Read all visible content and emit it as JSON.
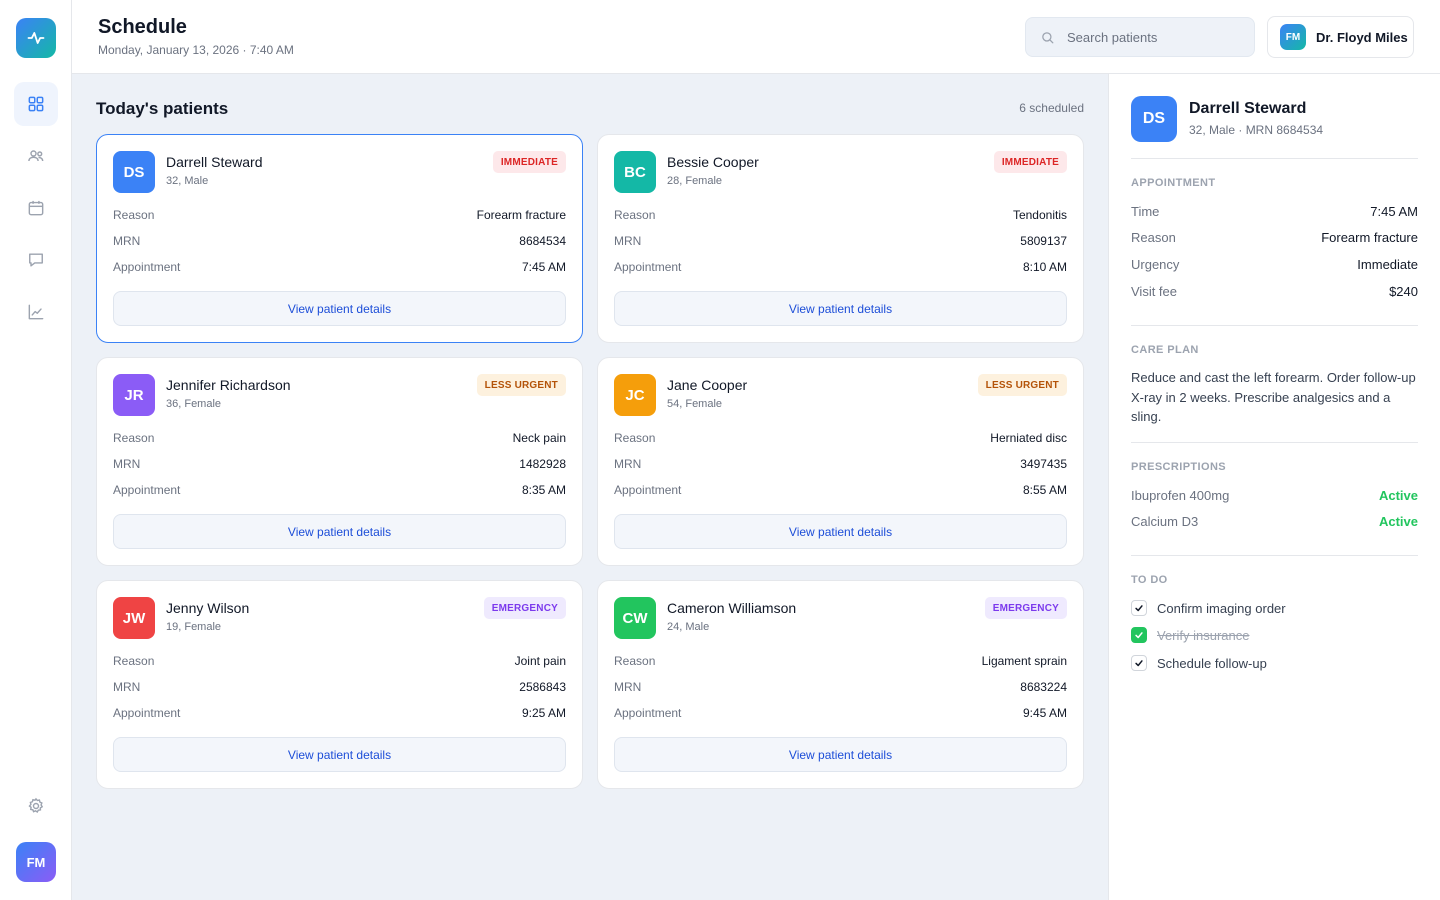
{
  "header": {
    "title": "Schedule",
    "date": "Monday, January 13, 2026 · 7:40 AM",
    "search_placeholder": "Search patients",
    "user_initials": "FM",
    "user_name": "Dr. Floyd Miles"
  },
  "sidebar": {
    "items": [
      {
        "icon": "dashboard-icon",
        "active": true
      },
      {
        "icon": "patients-icon",
        "active": false
      },
      {
        "icon": "calendar-icon",
        "active": false
      },
      {
        "icon": "chat-icon",
        "active": false
      },
      {
        "icon": "analytics-icon",
        "active": false
      }
    ],
    "settings_icon": "gear-icon",
    "avatar_initials": "FM"
  },
  "main": {
    "section_title": "Today's patients",
    "scheduled_count": "6 scheduled",
    "row_labels": {
      "reason": "Reason",
      "mrn": "MRN",
      "appointment": "Appointment"
    },
    "button_label": "View patient details",
    "patients": [
      {
        "initials": "DS",
        "name": "Darrell Steward",
        "meta": "32, Male",
        "badge": "IMMEDIATE",
        "badge_type": "immediate",
        "reason": "Forearm fracture",
        "mrn": "8684534",
        "appointment": "7:45 AM",
        "color": "#3b82f6"
      },
      {
        "initials": "BC",
        "name": "Bessie Cooper",
        "meta": "28, Female",
        "badge": "IMMEDIATE",
        "badge_type": "immediate",
        "reason": "Tendonitis",
        "mrn": "5809137",
        "appointment": "8:10 AM",
        "color": "#14b8a6"
      },
      {
        "initials": "JR",
        "name": "Jennifer Richardson",
        "meta": "36, Female",
        "badge": "LESS URGENT",
        "badge_type": "less",
        "reason": "Neck pain",
        "mrn": "1482928",
        "appointment": "8:35 AM",
        "color": "#8b5cf6"
      },
      {
        "initials": "JC",
        "name": "Jane Cooper",
        "meta": "54, Female",
        "badge": "LESS URGENT",
        "badge_type": "less",
        "reason": "Herniated disc",
        "mrn": "3497435",
        "appointment": "8:55 AM",
        "color": "#f59e0b"
      },
      {
        "initials": "JW",
        "name": "Jenny Wilson",
        "meta": "19, Female",
        "badge": "EMERGENCY",
        "badge_type": "emergency",
        "reason": "Joint pain",
        "mrn": "2586843",
        "appointment": "9:25 AM",
        "color": "#ef4444"
      },
      {
        "initials": "CW",
        "name": "Cameron Williamson",
        "meta": "24, Male",
        "badge": "EMERGENCY",
        "badge_type": "emergency",
        "reason": "Ligament sprain",
        "mrn": "8683224",
        "appointment": "9:45 AM",
        "color": "#22c55e"
      }
    ]
  },
  "detail": {
    "initials": "DS",
    "name": "Darrell Steward",
    "meta": "32, Male · MRN 8684534",
    "appointment_heading": "APPOINTMENT",
    "appointment": [
      {
        "label": "Time",
        "value": "7:45 AM"
      },
      {
        "label": "Reason",
        "value": "Forearm fracture"
      },
      {
        "label": "Urgency",
        "value": "Immediate"
      },
      {
        "label": "Visit fee",
        "value": "$240"
      }
    ],
    "careplan_heading": "CARE PLAN",
    "careplan_text": "Reduce and cast the left forearm. Order follow-up X-ray in 2 weeks. Prescribe analgesics and a sling.",
    "prescriptions_heading": "PRESCRIPTIONS",
    "prescriptions": [
      {
        "name": "Ibuprofen 400mg",
        "status": "Active"
      },
      {
        "name": "Calcium D3",
        "status": "Active"
      }
    ],
    "todo_heading": "TO DO",
    "todos": [
      {
        "text": "Confirm imaging order",
        "done": false
      },
      {
        "text": "Verify insurance",
        "done": true
      },
      {
        "text": "Schedule follow-up",
        "done": false
      }
    ]
  },
  "colors": {
    "accent": "#3b82f6",
    "active_status": "#22c55e"
  }
}
